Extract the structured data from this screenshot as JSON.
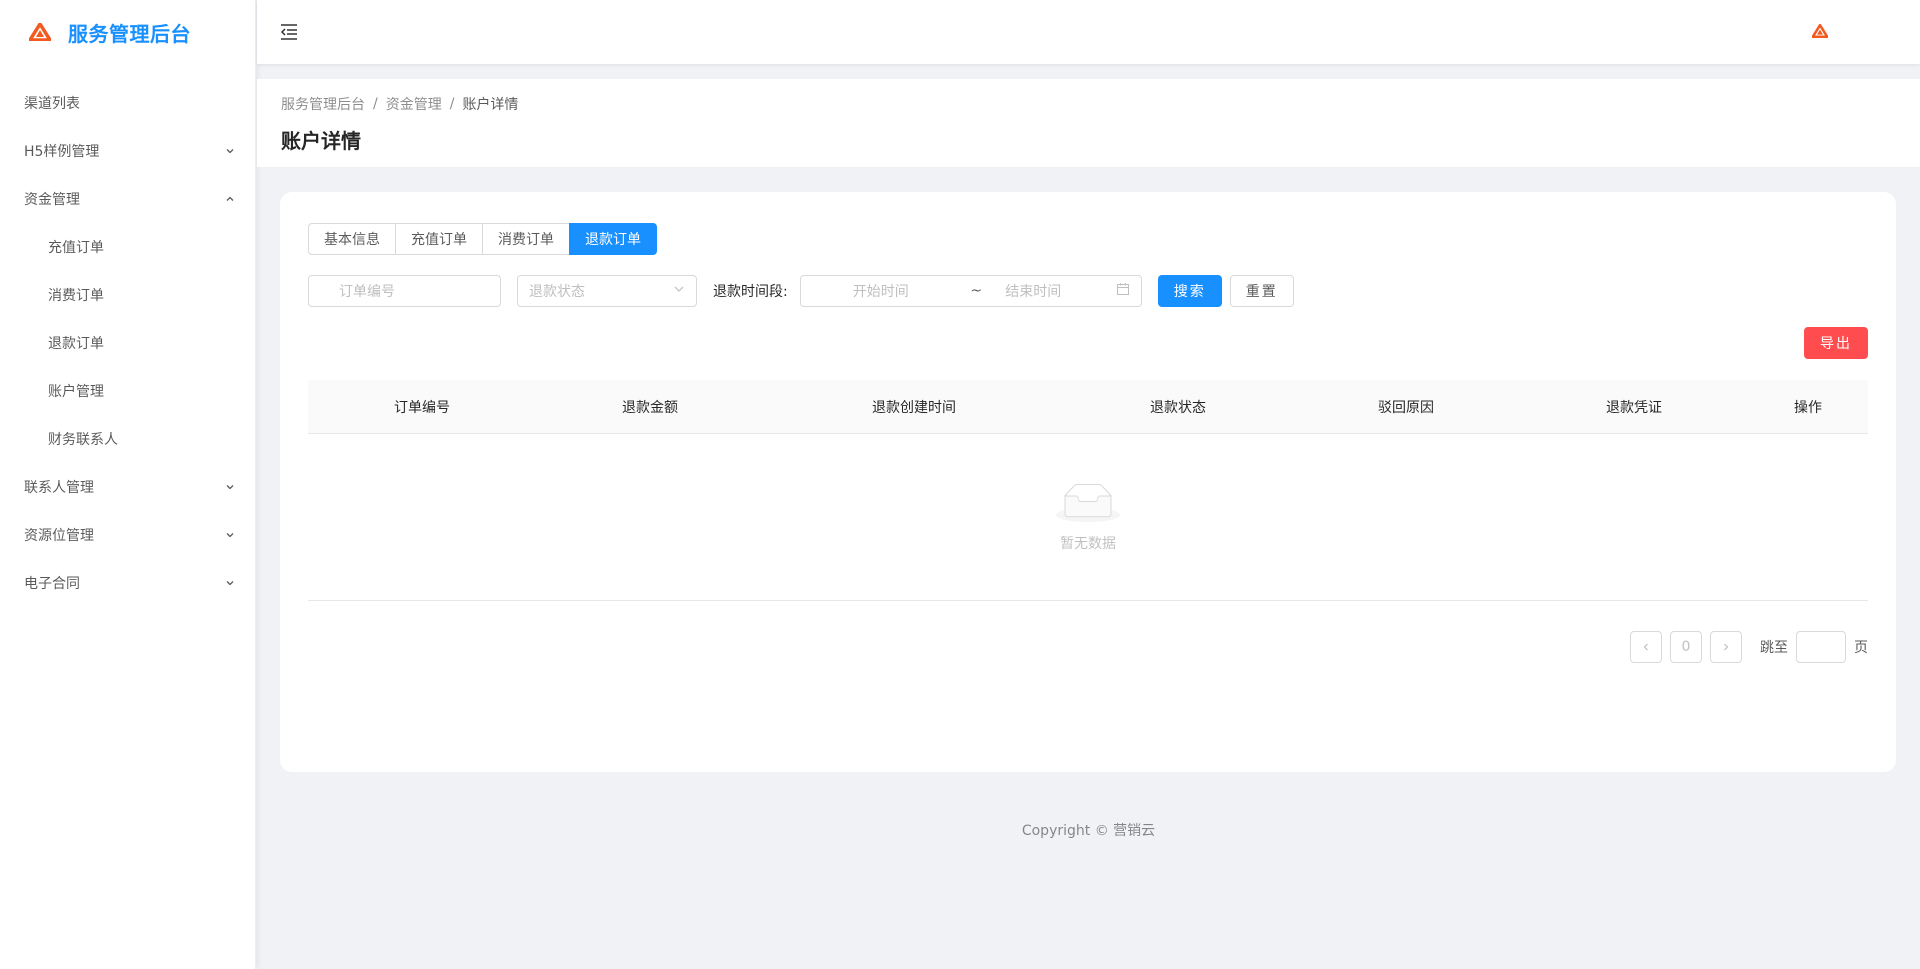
{
  "app": {
    "title": "服务管理后台",
    "brand_color": "#1890ff",
    "logo_color": "#f25a1f"
  },
  "sidebar": {
    "items": [
      {
        "label": "渠道列表",
        "expandable": false
      },
      {
        "label": "H5样例管理",
        "expandable": true,
        "expanded": false
      },
      {
        "label": "资金管理",
        "expandable": true,
        "expanded": true
      },
      {
        "label": "充值订单",
        "sub": true
      },
      {
        "label": "消费订单",
        "sub": true
      },
      {
        "label": "退款订单",
        "sub": true
      },
      {
        "label": "账户管理",
        "sub": true
      },
      {
        "label": "财务联系人",
        "sub": true
      },
      {
        "label": "联系人管理",
        "expandable": true,
        "expanded": false
      },
      {
        "label": "资源位管理",
        "expandable": true,
        "expanded": false
      },
      {
        "label": "电子合同",
        "expandable": true,
        "expanded": false
      }
    ]
  },
  "header": {
    "fold_icon": "menu-fold-icon",
    "avatar_icon": "logo-icon"
  },
  "breadcrumb": [
    "服务管理后台",
    "资金管理",
    "账户详情"
  ],
  "page_title": "账户详情",
  "tabs": [
    {
      "label": "基本信息",
      "active": false
    },
    {
      "label": "充值订单",
      "active": false
    },
    {
      "label": "消费订单",
      "active": false
    },
    {
      "label": "退款订单",
      "active": true
    }
  ],
  "filters": {
    "order_no_placeholder": "订单编号",
    "status_placeholder": "退款状态",
    "time_label": "退款时间段:",
    "start_placeholder": "开始时间",
    "range_sep": "~",
    "end_placeholder": "结束时间",
    "search_label": "搜索",
    "reset_label": "重置"
  },
  "export_label": "导出",
  "table": {
    "columns": [
      "订单编号",
      "退款金额",
      "退款创建时间",
      "退款状态",
      "驳回原因",
      "退款凭证",
      "操作"
    ],
    "rows": [],
    "empty_text": "暂无数据"
  },
  "pagination": {
    "current": "0",
    "jump_label": "跳至",
    "jump_unit": "页"
  },
  "footer": "Copyright © 营销云",
  "colors": {
    "primary": "#1890ff",
    "danger": "#ff4d4f"
  }
}
